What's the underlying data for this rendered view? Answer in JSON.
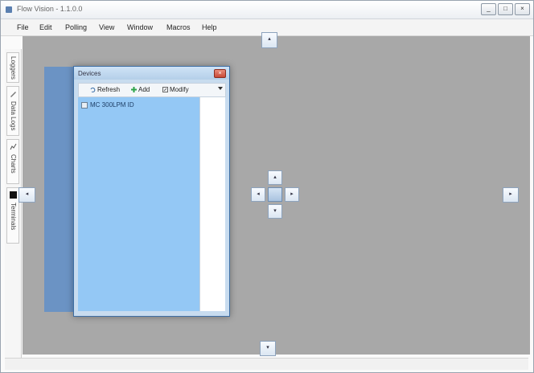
{
  "window": {
    "title": "Flow Vision - 1.1.0.0"
  },
  "titlebar_buttons": [
    "_",
    "□",
    "×"
  ],
  "menu": [
    "File",
    "Edit",
    "Polling",
    "View",
    "Window",
    "Macros",
    "Help"
  ],
  "sidebar": {
    "tabs": [
      "Loggers",
      "Data Logs",
      "Charts",
      "Terminals"
    ]
  },
  "devices_panel": {
    "title": "Devices",
    "toolbar": {
      "refresh": "Refresh",
      "add": "Add",
      "modify": "Modify"
    },
    "items": [
      "MC 300LPM ID"
    ]
  },
  "dock_guides": {
    "left": "◂",
    "right": "▸",
    "up": "▴",
    "down": "▾"
  },
  "colors": {
    "workspace": "#a8a8a8",
    "panel_list": "#94c8f5",
    "accent": "#3f6fa5"
  }
}
